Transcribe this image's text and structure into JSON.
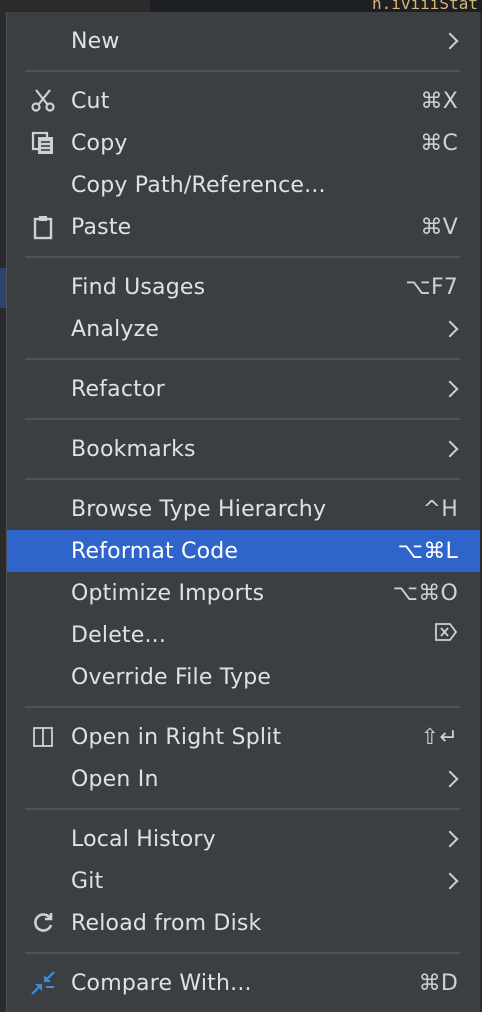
{
  "editor": {
    "snippet": "n.iviiiStat"
  },
  "menu": {
    "items": [
      {
        "label": "New",
        "submenu": true
      },
      {
        "label": "Cut",
        "shortcut": "⌘X",
        "icon": "scissors-icon"
      },
      {
        "label": "Copy",
        "shortcut": "⌘C",
        "icon": "copy-icon"
      },
      {
        "label": "Copy Path/Reference..."
      },
      {
        "label": "Paste",
        "shortcut": "⌘V",
        "icon": "clipboard-icon"
      },
      {
        "label": "Find Usages",
        "shortcut": "⌥F7"
      },
      {
        "label": "Analyze",
        "submenu": true
      },
      {
        "label": "Refactor",
        "submenu": true
      },
      {
        "label": "Bookmarks",
        "submenu": true
      },
      {
        "label": "Browse Type Hierarchy",
        "shortcut": "^H"
      },
      {
        "label": "Reformat Code",
        "shortcut": "⌥⌘L",
        "selected": true
      },
      {
        "label": "Optimize Imports",
        "shortcut": "⌥⌘O"
      },
      {
        "label": "Delete...",
        "shortcut_icon": "delete-key-icon"
      },
      {
        "label": "Override File Type"
      },
      {
        "label": "Open in Right Split",
        "shortcut": "⇧↵",
        "icon": "split-view-icon"
      },
      {
        "label": "Open In",
        "submenu": true
      },
      {
        "label": "Local History",
        "submenu": true
      },
      {
        "label": "Git",
        "submenu": true
      },
      {
        "label": "Reload from Disk",
        "icon": "reload-icon"
      },
      {
        "label": "Compare With...",
        "shortcut": "⌘D",
        "icon": "compare-arrows-icon"
      }
    ]
  },
  "colors": {
    "menu_background": "#3c3f41",
    "selection": "#2f65ca",
    "text": "#dfe1e5",
    "separator": "#505356"
  }
}
